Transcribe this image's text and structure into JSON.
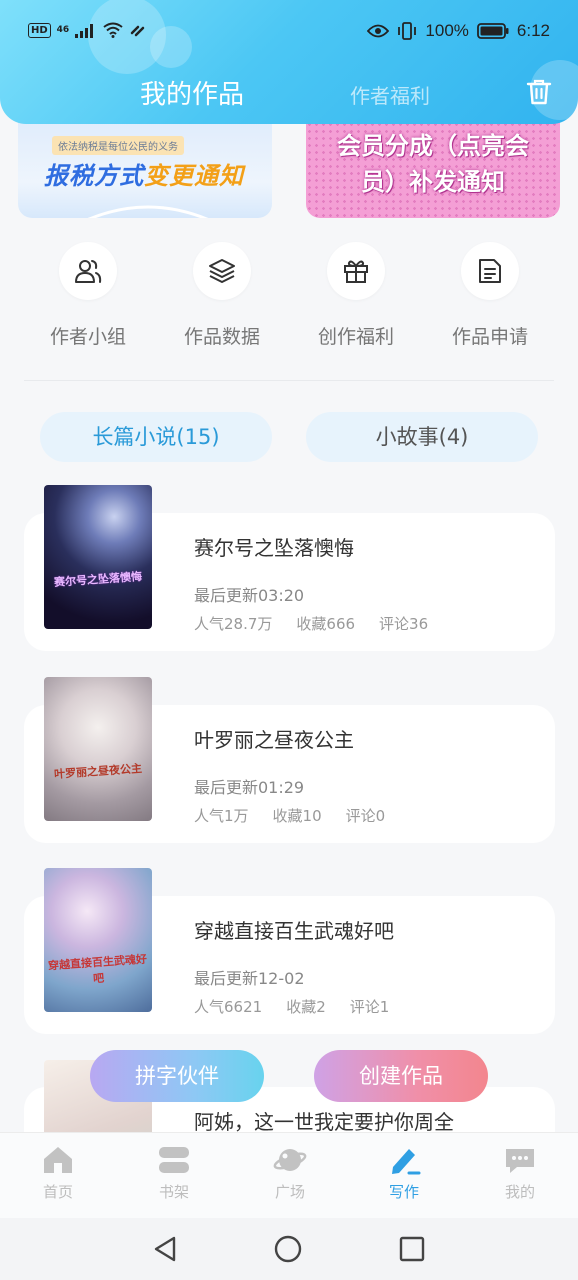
{
  "status_bar": {
    "left_badge": "HD",
    "signal_label": "46",
    "battery_percent": "100%",
    "time": "6:12"
  },
  "header": {
    "tab_active": "我的作品",
    "tab_inactive": "作者福利",
    "trash_icon": "trash-icon"
  },
  "banners": [
    {
      "tagline": "依法纳税是每位公民的义务",
      "title_part1": "报税方式",
      "title_part2": "变更通知"
    },
    {
      "line1": "会员分成（点亮会",
      "line2": "员）补发通知"
    }
  ],
  "menu": [
    {
      "label": "作者小组",
      "icon": "users-icon"
    },
    {
      "label": "作品数据",
      "icon": "layers-icon"
    },
    {
      "label": "创作福利",
      "icon": "gift-icon"
    },
    {
      "label": "作品申请",
      "icon": "document-icon"
    }
  ],
  "category_tabs": {
    "active": "长篇小说(15)",
    "inactive": "小故事(4)"
  },
  "works": [
    {
      "title": "赛尔号之坠落懊悔",
      "updated": "最后更新03:20",
      "popularity": "人气28.7万",
      "favorites": "收藏666",
      "comments": "评论36",
      "cover_text": "赛尔号之坠落懊悔"
    },
    {
      "title": "叶罗丽之昼夜公主",
      "updated": "最后更新01:29",
      "popularity": "人气1万",
      "favorites": "收藏10",
      "comments": "评论0",
      "cover_text": "叶罗丽之昼夜公主"
    },
    {
      "title": "穿越直接百生武魂好吧",
      "updated": "最后更新12-02",
      "popularity": "人气6621",
      "favorites": "收藏2",
      "comments": "评论1",
      "cover_text": "穿越直接百生武魂好吧"
    },
    {
      "title": "阿姊，这一世我定要护你周全"
    }
  ],
  "floating_buttons": {
    "partner": "拼字伙伴",
    "create": "创建作品"
  },
  "bottom_nav": [
    {
      "label": "首页",
      "icon": "home-icon"
    },
    {
      "label": "书架",
      "icon": "bookshelf-icon"
    },
    {
      "label": "广场",
      "icon": "planet-icon"
    },
    {
      "label": "写作",
      "icon": "pen-icon",
      "active": true
    },
    {
      "label": "我的",
      "icon": "chat-icon"
    }
  ],
  "colors": {
    "accent": "#2f9fe3",
    "header_gradient_start": "#7fe0fb",
    "header_gradient_end": "#31b3ef"
  }
}
